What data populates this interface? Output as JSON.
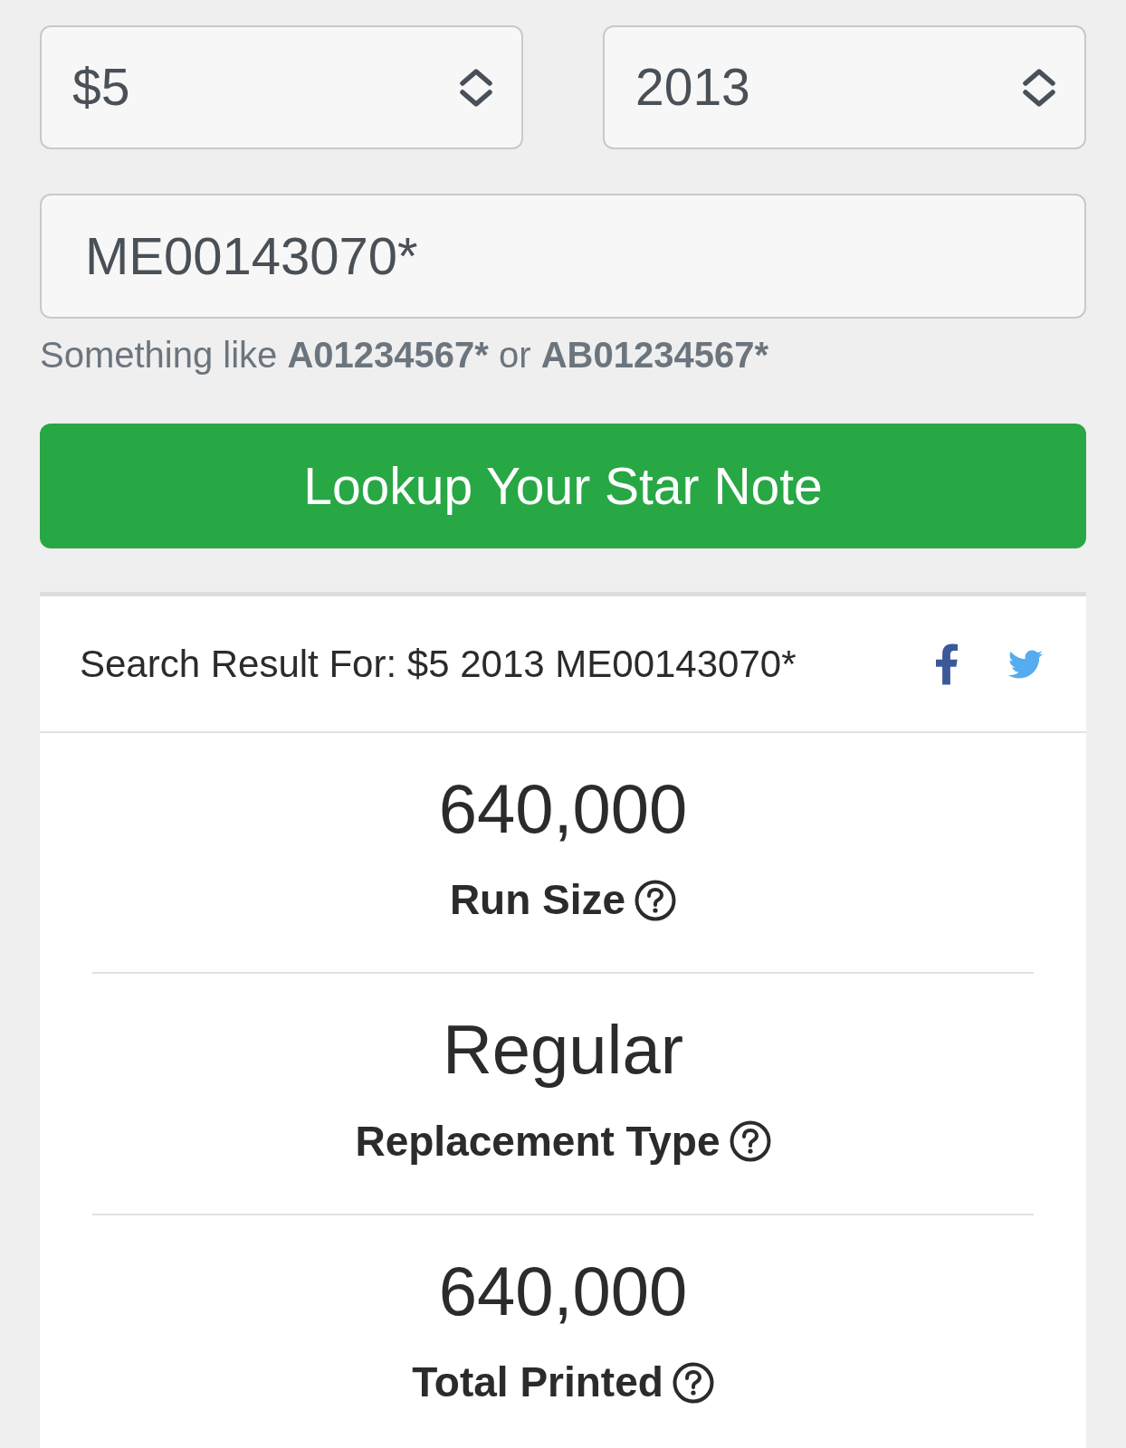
{
  "filters": [
    {
      "kind": "select",
      "value": "$5"
    },
    {
      "kind": "select",
      "value": "2013"
    }
  ],
  "serial_field": {
    "value": "ME00143070*"
  },
  "hint": [
    {
      "text": "Something like ",
      "bold": false
    },
    {
      "text": "A01234567*",
      "bold": true
    },
    {
      "text": " or ",
      "bold": false
    },
    {
      "text": "AB01234567*",
      "bold": true
    }
  ],
  "search_button": {
    "label": "Lookup Your Star Note"
  },
  "result": {
    "title": "Search Result For: $5 2013 ME00143070*",
    "share_links": [
      {
        "kind": "facebook"
      },
      {
        "kind": "twitter"
      }
    ],
    "stats": [
      {
        "value": "640,000",
        "label": "Run Size"
      },
      {
        "value": "Regular",
        "label": "Replacement Type"
      },
      {
        "value": "640,000",
        "label": "Total Printed"
      }
    ]
  }
}
